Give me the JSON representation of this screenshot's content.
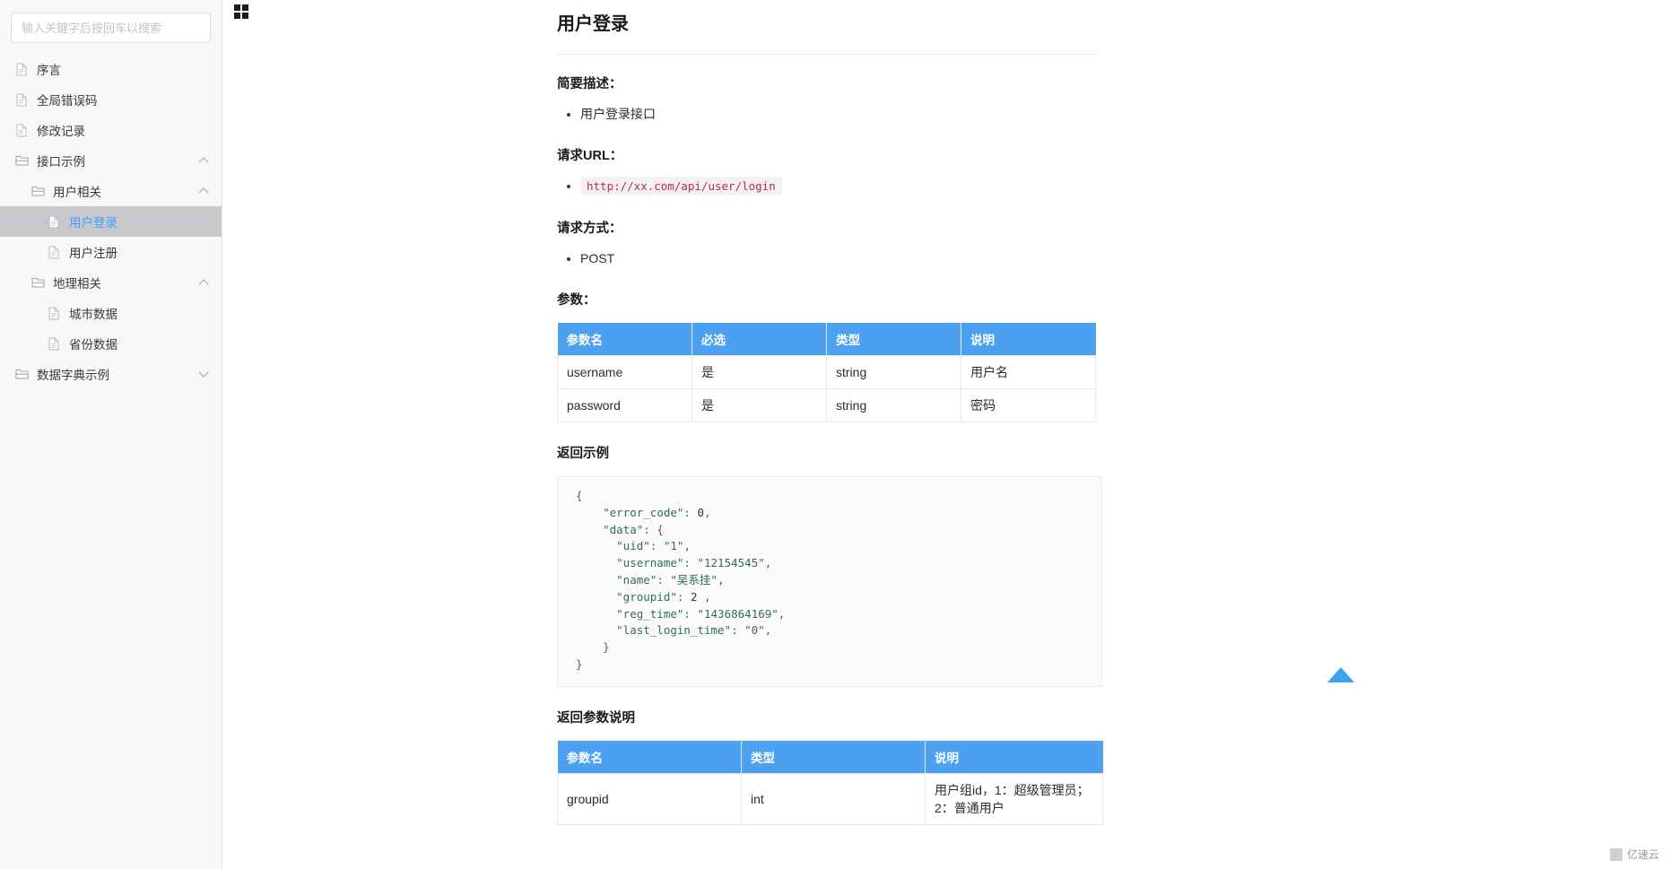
{
  "sidebar": {
    "search": {
      "placeholder": "输入关键字后按回车以搜索",
      "value": ""
    },
    "items": [
      {
        "label": "序言",
        "icon": "file-icon",
        "depth": 0,
        "type": "file",
        "active": false,
        "chevron": ""
      },
      {
        "label": "全局错误码",
        "icon": "file-icon",
        "depth": 0,
        "type": "file",
        "active": false,
        "chevron": ""
      },
      {
        "label": "修改记录",
        "icon": "file-icon",
        "depth": 0,
        "type": "file",
        "active": false,
        "chevron": ""
      },
      {
        "label": "接口示例",
        "icon": "folder-icon",
        "depth": 0,
        "type": "folder",
        "active": false,
        "chevron": "up"
      },
      {
        "label": "用户相关",
        "icon": "folder-icon",
        "depth": 1,
        "type": "folder",
        "active": false,
        "chevron": "up"
      },
      {
        "label": "用户登录",
        "icon": "file-icon",
        "depth": 2,
        "type": "file",
        "active": true,
        "chevron": ""
      },
      {
        "label": "用户注册",
        "icon": "file-icon",
        "depth": 2,
        "type": "file",
        "active": false,
        "chevron": ""
      },
      {
        "label": "地理相关",
        "icon": "folder-icon",
        "depth": 1,
        "type": "folder",
        "active": false,
        "chevron": "up"
      },
      {
        "label": "城市数据",
        "icon": "file-icon",
        "depth": 2,
        "type": "file",
        "active": false,
        "chevron": ""
      },
      {
        "label": "省份数据",
        "icon": "file-icon",
        "depth": 2,
        "type": "file",
        "active": false,
        "chevron": ""
      },
      {
        "label": "数据字典示例",
        "icon": "folder-icon",
        "depth": 0,
        "type": "folder",
        "active": false,
        "chevron": "down"
      }
    ]
  },
  "main": {
    "grid_toggle_name": "grid-menu-icon",
    "title": "用户登录",
    "sections": {
      "desc_heading": "简要描述：",
      "desc_items": [
        "用户登录接口"
      ],
      "url_heading": "请求URL：",
      "url_value": "http://xx.com/api/user/login",
      "method_heading": "请求方式：",
      "method_items": [
        "POST"
      ],
      "params_heading": "参数：",
      "return_example_heading": "返回示例",
      "return_params_heading": "返回参数说明"
    },
    "params_table": {
      "columns": [
        "参数名",
        "必选",
        "类型",
        "说明"
      ],
      "rows": [
        [
          "username",
          "是",
          "string",
          "用户名"
        ],
        [
          "password",
          "是",
          "string",
          "密码"
        ]
      ]
    },
    "return_example_code": "{\n    \"error_code\": 0,\n    \"data\": {\n      \"uid\": \"1\",\n      \"username\": \"12154545\",\n      \"name\": \"吴系挂\",\n      \"groupid\": 2 ,\n      \"reg_time\": \"1436864169\",\n      \"last_login_time\": \"0\",\n    }\n}",
    "return_params_table": {
      "columns": [
        "参数名",
        "类型",
        "说明"
      ],
      "rows": [
        [
          "groupid",
          "int",
          "用户组id，1：超级管理员；2：普通用户"
        ]
      ]
    },
    "back_to_top_label": "回到顶部",
    "watermark": "亿速云"
  },
  "colors": {
    "table_header_bg": "#4ba0f0",
    "active_item_text": "#409eff",
    "active_item_bg": "#c8c9cc",
    "code_string": "#2f6f4f",
    "url_code_text": "#c7254e",
    "back_top": "#3aa3f5"
  }
}
